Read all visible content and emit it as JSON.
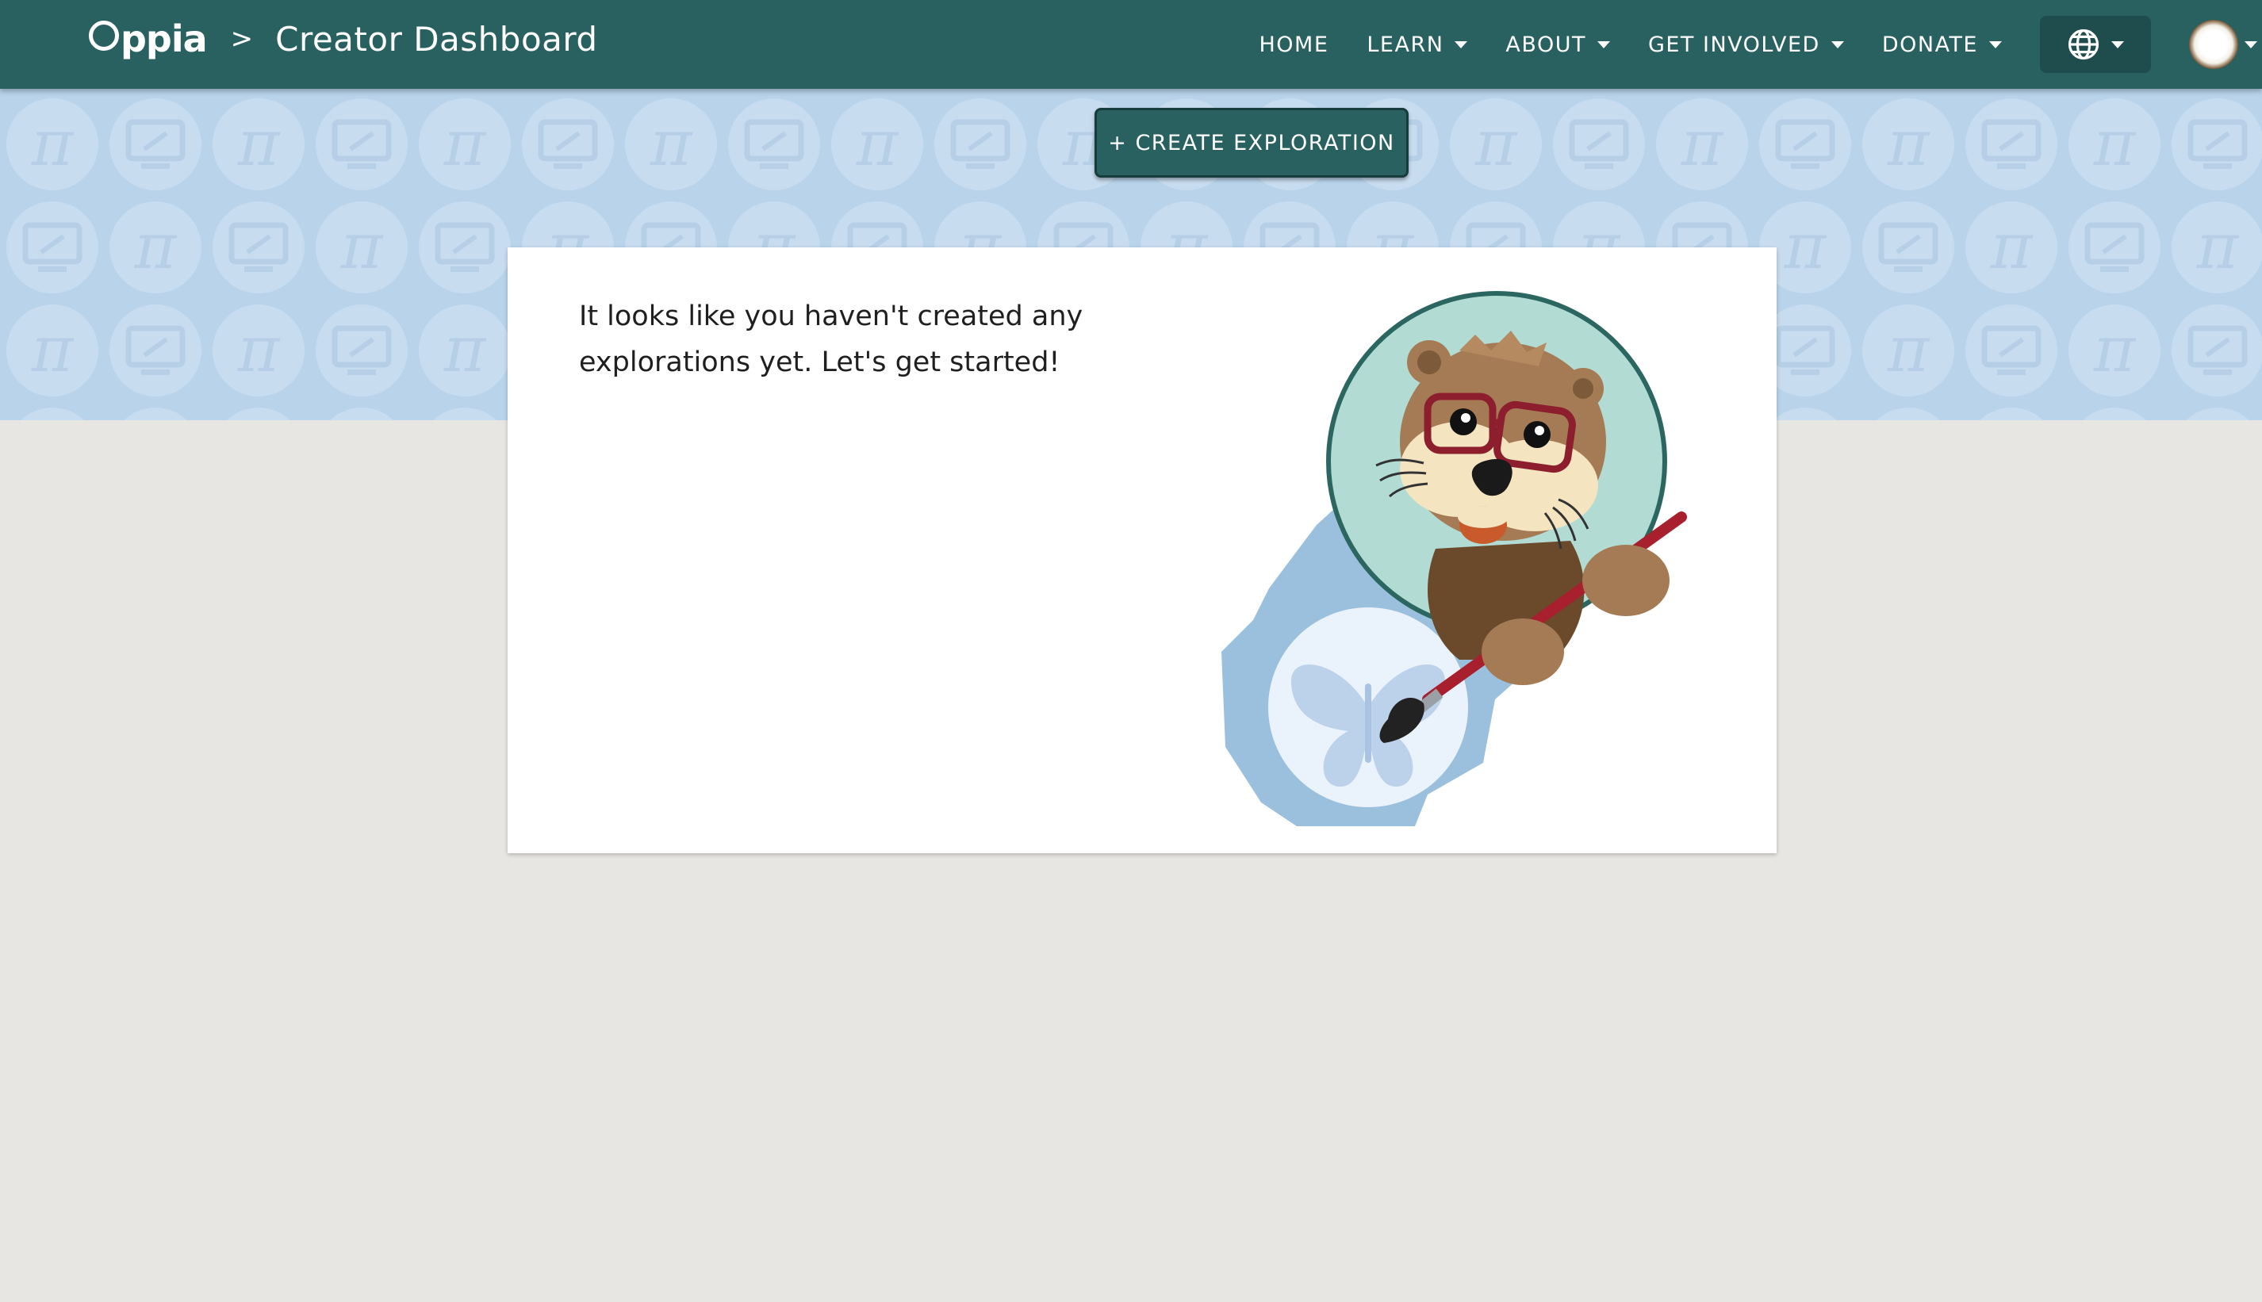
{
  "header": {
    "brand": "ppia",
    "breadcrumb_separator": ">",
    "page_title": "Creator Dashboard",
    "nav": {
      "home": "HOME",
      "learn": "LEARN",
      "about": "ABOUT",
      "get_involved": "GET INVOLVED",
      "donate": "DONATE"
    },
    "language_icon": "globe-icon",
    "avatar_icon": "user-avatar"
  },
  "banner": {
    "pattern_icons": [
      "pi-icon",
      "monitor-icon"
    ]
  },
  "actions": {
    "create_exploration": "+ CREATE EXPLORATION"
  },
  "card": {
    "message": "It looks like you haven't created any explorations yet. Let's get started!",
    "illustration": "otter-painting-illustration"
  },
  "colors": {
    "header_bg": "#296161",
    "banner_bg": "#b8d3ea",
    "page_bg": "#e8e6e2",
    "button_bg": "#296161"
  }
}
